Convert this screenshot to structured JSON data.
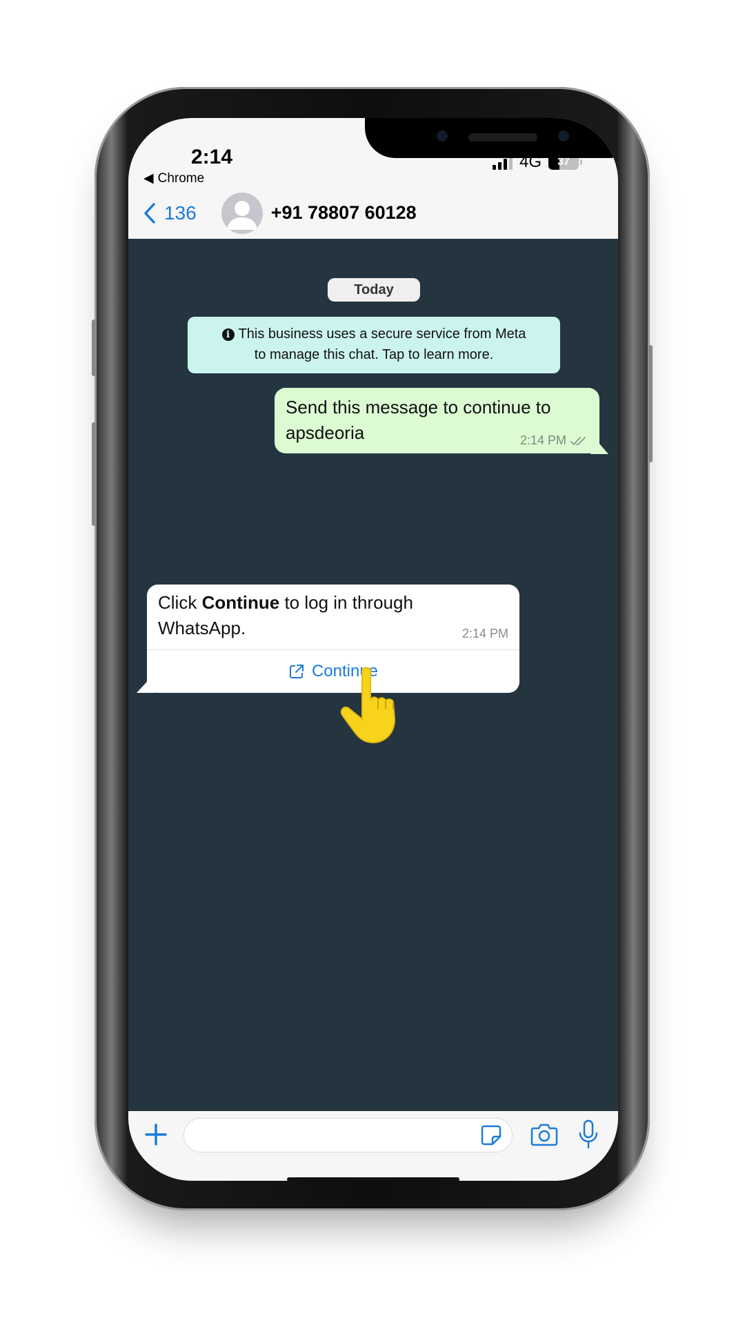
{
  "status_bar": {
    "time": "2:14",
    "back_app": "Chrome",
    "network": "4G",
    "battery": "37",
    "battery_level_percent": 37,
    "signal_bars_active": 3,
    "signal_bars_total": 4
  },
  "header": {
    "back_count": "136",
    "contact_name": "+91 78807 60128"
  },
  "chat": {
    "date_chip": "Today",
    "system_message_line1": "This business uses a secure service from Meta",
    "system_message_line2": "to manage this chat. Tap to learn more.",
    "outgoing": {
      "text": "Send this message to continue to apsdeoria",
      "time": "2:14 PM",
      "read_status": "double-check-icon"
    },
    "incoming": {
      "text_before": "Click ",
      "text_bold": "Continue",
      "text_after": " to log in through WhatsApp.",
      "time": "2:14 PM",
      "button_label": "Continue"
    }
  },
  "input_bar": {
    "placeholder": ""
  },
  "colors": {
    "accent": "#1a7bd8",
    "chat_bg": "#243540",
    "outgoing_bubble": "#dcfbd3",
    "system_bubble": "#ccf4ef",
    "hand": "#f7d31c"
  }
}
